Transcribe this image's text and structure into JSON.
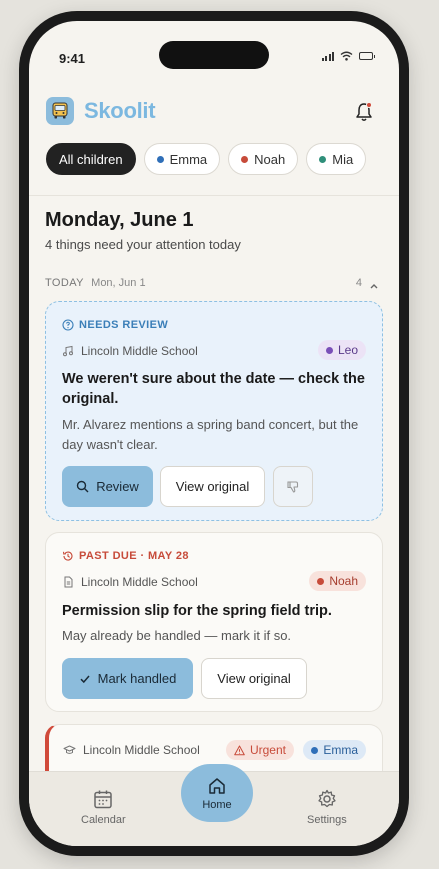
{
  "status_bar": {
    "time": "9:41"
  },
  "header": {
    "app_name": "Skoolit",
    "icons": [
      "bus-logo-icon",
      "bell-icon"
    ]
  },
  "filters": {
    "chips": [
      {
        "label": "All children",
        "active": true
      },
      {
        "label": "Emma",
        "color": "#2f6fb8"
      },
      {
        "label": "Noah",
        "color": "#c74b3a"
      },
      {
        "label": "Mia",
        "color": "#2f8f7a"
      }
    ]
  },
  "day": {
    "title": "Monday, June 1",
    "subtitle": "4 things need your attention today"
  },
  "section": {
    "label": "TODAY",
    "date": "Mon, Jun 1",
    "count": "4"
  },
  "cards": [
    {
      "tag": "NEEDS REVIEW",
      "school": "Lincoln Middle School",
      "child": "Leo",
      "child_color": "#7a4fb8",
      "title": "We weren't sure about the date — check the original.",
      "description": "Mr. Alvarez mentions a spring band concert, but the day wasn't clear.",
      "buttons": {
        "primary": "Review",
        "secondary": "View original"
      }
    },
    {
      "tag": "PAST DUE · MAY 28",
      "school": "Lincoln Middle School",
      "child": "Noah",
      "child_color": "#c74b3a",
      "title": "Permission slip for the spring field trip.",
      "description": "May already be handled — mark it if so.",
      "buttons": {
        "primary": "Mark handled",
        "secondary": "View original"
      }
    },
    {
      "school": "Lincoln Middle School",
      "urgent_label": "Urgent",
      "child": "Emma",
      "child_color": "#2f6fb8"
    }
  ],
  "bottom_nav": {
    "calendar": "Calendar",
    "home": "Home",
    "settings": "Settings"
  },
  "colors": {
    "accent": "#8cbcdc",
    "brand_text": "#7cb8e0",
    "urgent": "#d04a3a"
  }
}
